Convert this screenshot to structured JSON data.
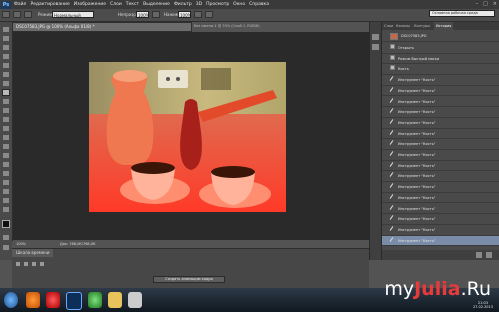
{
  "app": {
    "logo": "Ps"
  },
  "menubar": {
    "items": [
      "Файл",
      "Редактирование",
      "Изображение",
      "Слои",
      "Текст",
      "Выделение",
      "Фильтр",
      "3D",
      "Просмотр",
      "Окно",
      "Справка"
    ]
  },
  "options": {
    "mode_label": "Режим:",
    "mode_value": "Нормальный",
    "opacity_label": "Непрозр.:",
    "opacity_value": "100%",
    "flow_label": "Нажим:",
    "flow_value": "100%",
    "workspace": "Основная рабочая среда"
  },
  "document": {
    "tab_title": "DSC07583.JPG @ 100% (Альфа 01/8) *",
    "info_text": "Без имени-1 @ 33% (Слой 1, RGB/8)",
    "zoom": "100%",
    "doc_size": "Док: 768,0К/768,0К"
  },
  "timeline": {
    "tab_label": "Шкала времени",
    "create_button": "Создать анимацию кадра"
  },
  "history": {
    "tabs": [
      "Слои",
      "Каналы",
      "Контуры",
      "История"
    ],
    "active_tab": "История",
    "snapshot": "DSC07583.JPG",
    "items": [
      "Открыть",
      "Режим быстрой маски",
      "Кисть",
      "Инструмент \"Кисть\"",
      "Инструмент \"Кисть\"",
      "Инструмент \"Кисть\"",
      "Инструмент \"Кисть\"",
      "Инструмент \"Кисть\"",
      "Инструмент \"Кисть\"",
      "Инструмент \"Кисть\"",
      "Инструмент \"Кисть\"",
      "Инструмент \"Кисть\"",
      "Инструмент \"Кисть\"",
      "Инструмент \"Кисть\"",
      "Инструмент \"Кисть\"",
      "Инструмент \"Кисть\"",
      "Инструмент \"Кисть\"",
      "Инструмент \"Кисть\"",
      "Инструмент \"Кисть\""
    ],
    "selected_index": 18
  },
  "taskbar": {
    "clock_time": "21:03",
    "clock_date": "27.02.2013"
  },
  "watermark": {
    "pre": "my",
    "mid": "Julia",
    "post": ".Ru"
  },
  "colors": {
    "history_selected": "#7a8ca7",
    "watermark_accent": "#e83a3a"
  }
}
